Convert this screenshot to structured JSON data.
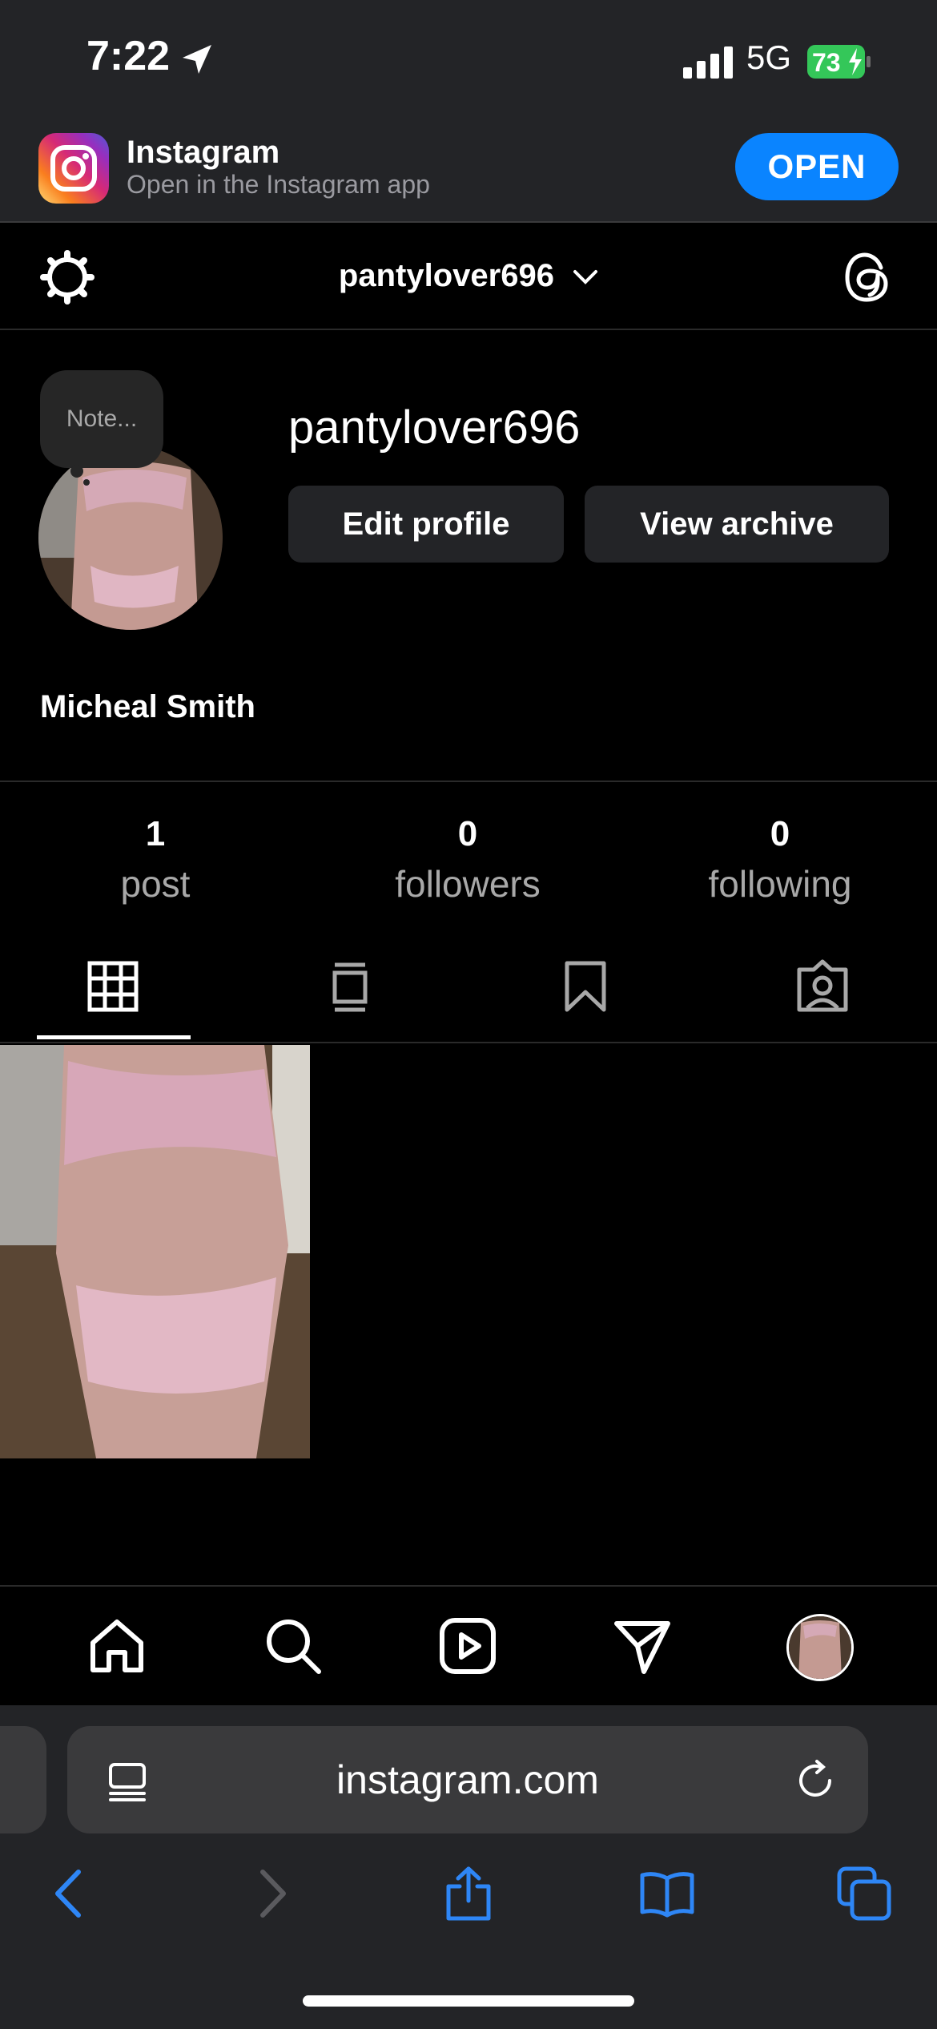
{
  "status_bar": {
    "time": "7:22",
    "network": "5G",
    "battery": "73"
  },
  "banner": {
    "title": "Instagram",
    "subtitle": "Open in the Instagram app",
    "open_label": "OPEN"
  },
  "header": {
    "username": "pantylover696"
  },
  "profile": {
    "note": "Note...",
    "username": "pantylover696",
    "edit_label": "Edit profile",
    "archive_label": "View archive",
    "full_name": "Micheal Smith"
  },
  "stats": [
    {
      "count": "1",
      "label": "post"
    },
    {
      "count": "0",
      "label": "followers"
    },
    {
      "count": "0",
      "label": "following"
    }
  ],
  "tabs": [
    "grid-icon",
    "feed-icon",
    "bookmark-icon",
    "tagged-icon"
  ],
  "bottom_nav": [
    "home-icon",
    "search-icon",
    "reels-icon",
    "direct-icon",
    "profile-avatar"
  ],
  "browser": {
    "url": "instagram.com"
  },
  "colors": {
    "accent": "#0a84ff",
    "bar": "#232427",
    "battery": "#34c759"
  }
}
